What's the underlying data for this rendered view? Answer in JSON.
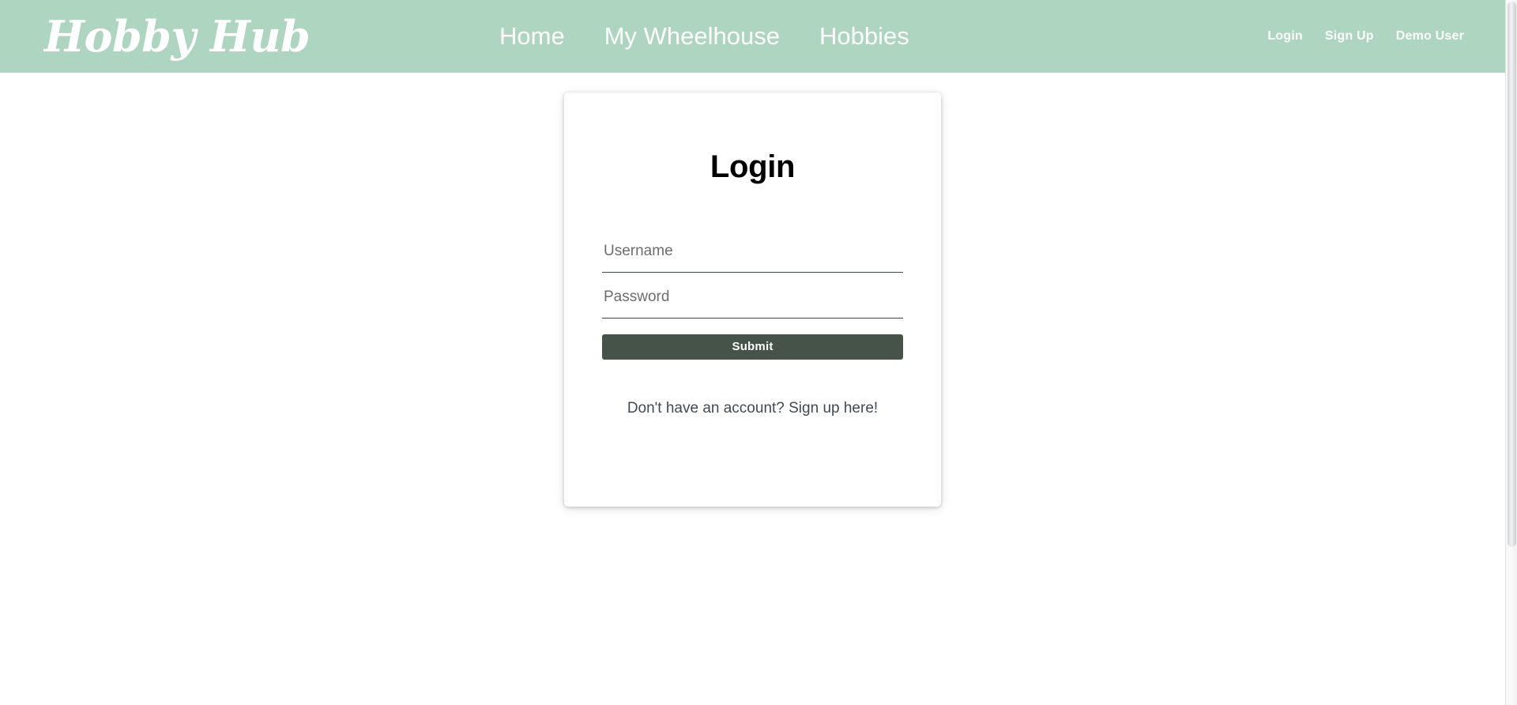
{
  "theme": {
    "header_green": "#aed5c0",
    "button_dark_green": "#465349",
    "card_background": "#ffffff",
    "page_background": "#ffffff",
    "placeholder_gray": "#6d6d6d",
    "link_slate": "#3f4a52",
    "input_underline": "#3d4a42"
  },
  "header": {
    "brand": "Hobby Hub",
    "nav_main": [
      {
        "label": "Home"
      },
      {
        "label": "My Wheelhouse"
      },
      {
        "label": "Hobbies"
      }
    ],
    "nav_auth": [
      {
        "label": "Login"
      },
      {
        "label": "Sign Up"
      },
      {
        "label": "Demo User"
      }
    ]
  },
  "login_card": {
    "title": "Login",
    "fields": {
      "username": {
        "placeholder": "Username",
        "value": ""
      },
      "password": {
        "placeholder": "Password",
        "value": ""
      }
    },
    "submit_label": "Submit",
    "signup_prompt": "Don't have an account? Sign up here!"
  }
}
